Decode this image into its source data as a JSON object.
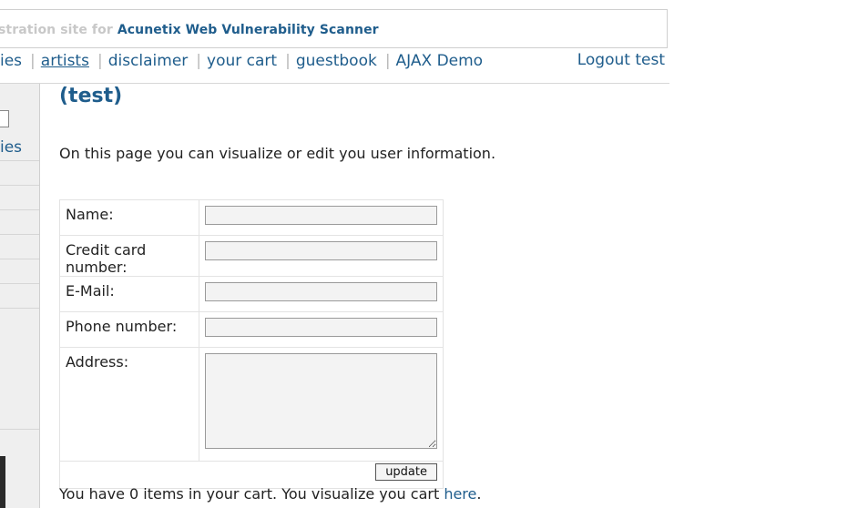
{
  "banner": {
    "prefix": "stration site for ",
    "brand": "Acunetix Web Vulnerability Scanner"
  },
  "nav": {
    "items": [
      {
        "label": "ies"
      },
      {
        "label": "artists"
      },
      {
        "label": "disclaimer"
      },
      {
        "label": "your cart"
      },
      {
        "label": "guestbook"
      },
      {
        "label": "AJAX Demo"
      }
    ],
    "separator": "|",
    "logout": "Logout test"
  },
  "sidebar": {
    "link": "ies"
  },
  "main": {
    "title": "(test)",
    "intro": "On this page you can visualize or edit you user information.",
    "form": {
      "name_label": "Name:",
      "name_value": "",
      "cc_label": "Credit card number:",
      "cc_value": "",
      "email_label": "E-Mail:",
      "email_value": "",
      "phone_label": "Phone number:",
      "phone_value": "",
      "address_label": "Address:",
      "address_value": "",
      "update_label": "update"
    },
    "cart": {
      "text": "You have 0 items in your cart. You visualize you cart ",
      "link": "here",
      "end": "."
    }
  }
}
